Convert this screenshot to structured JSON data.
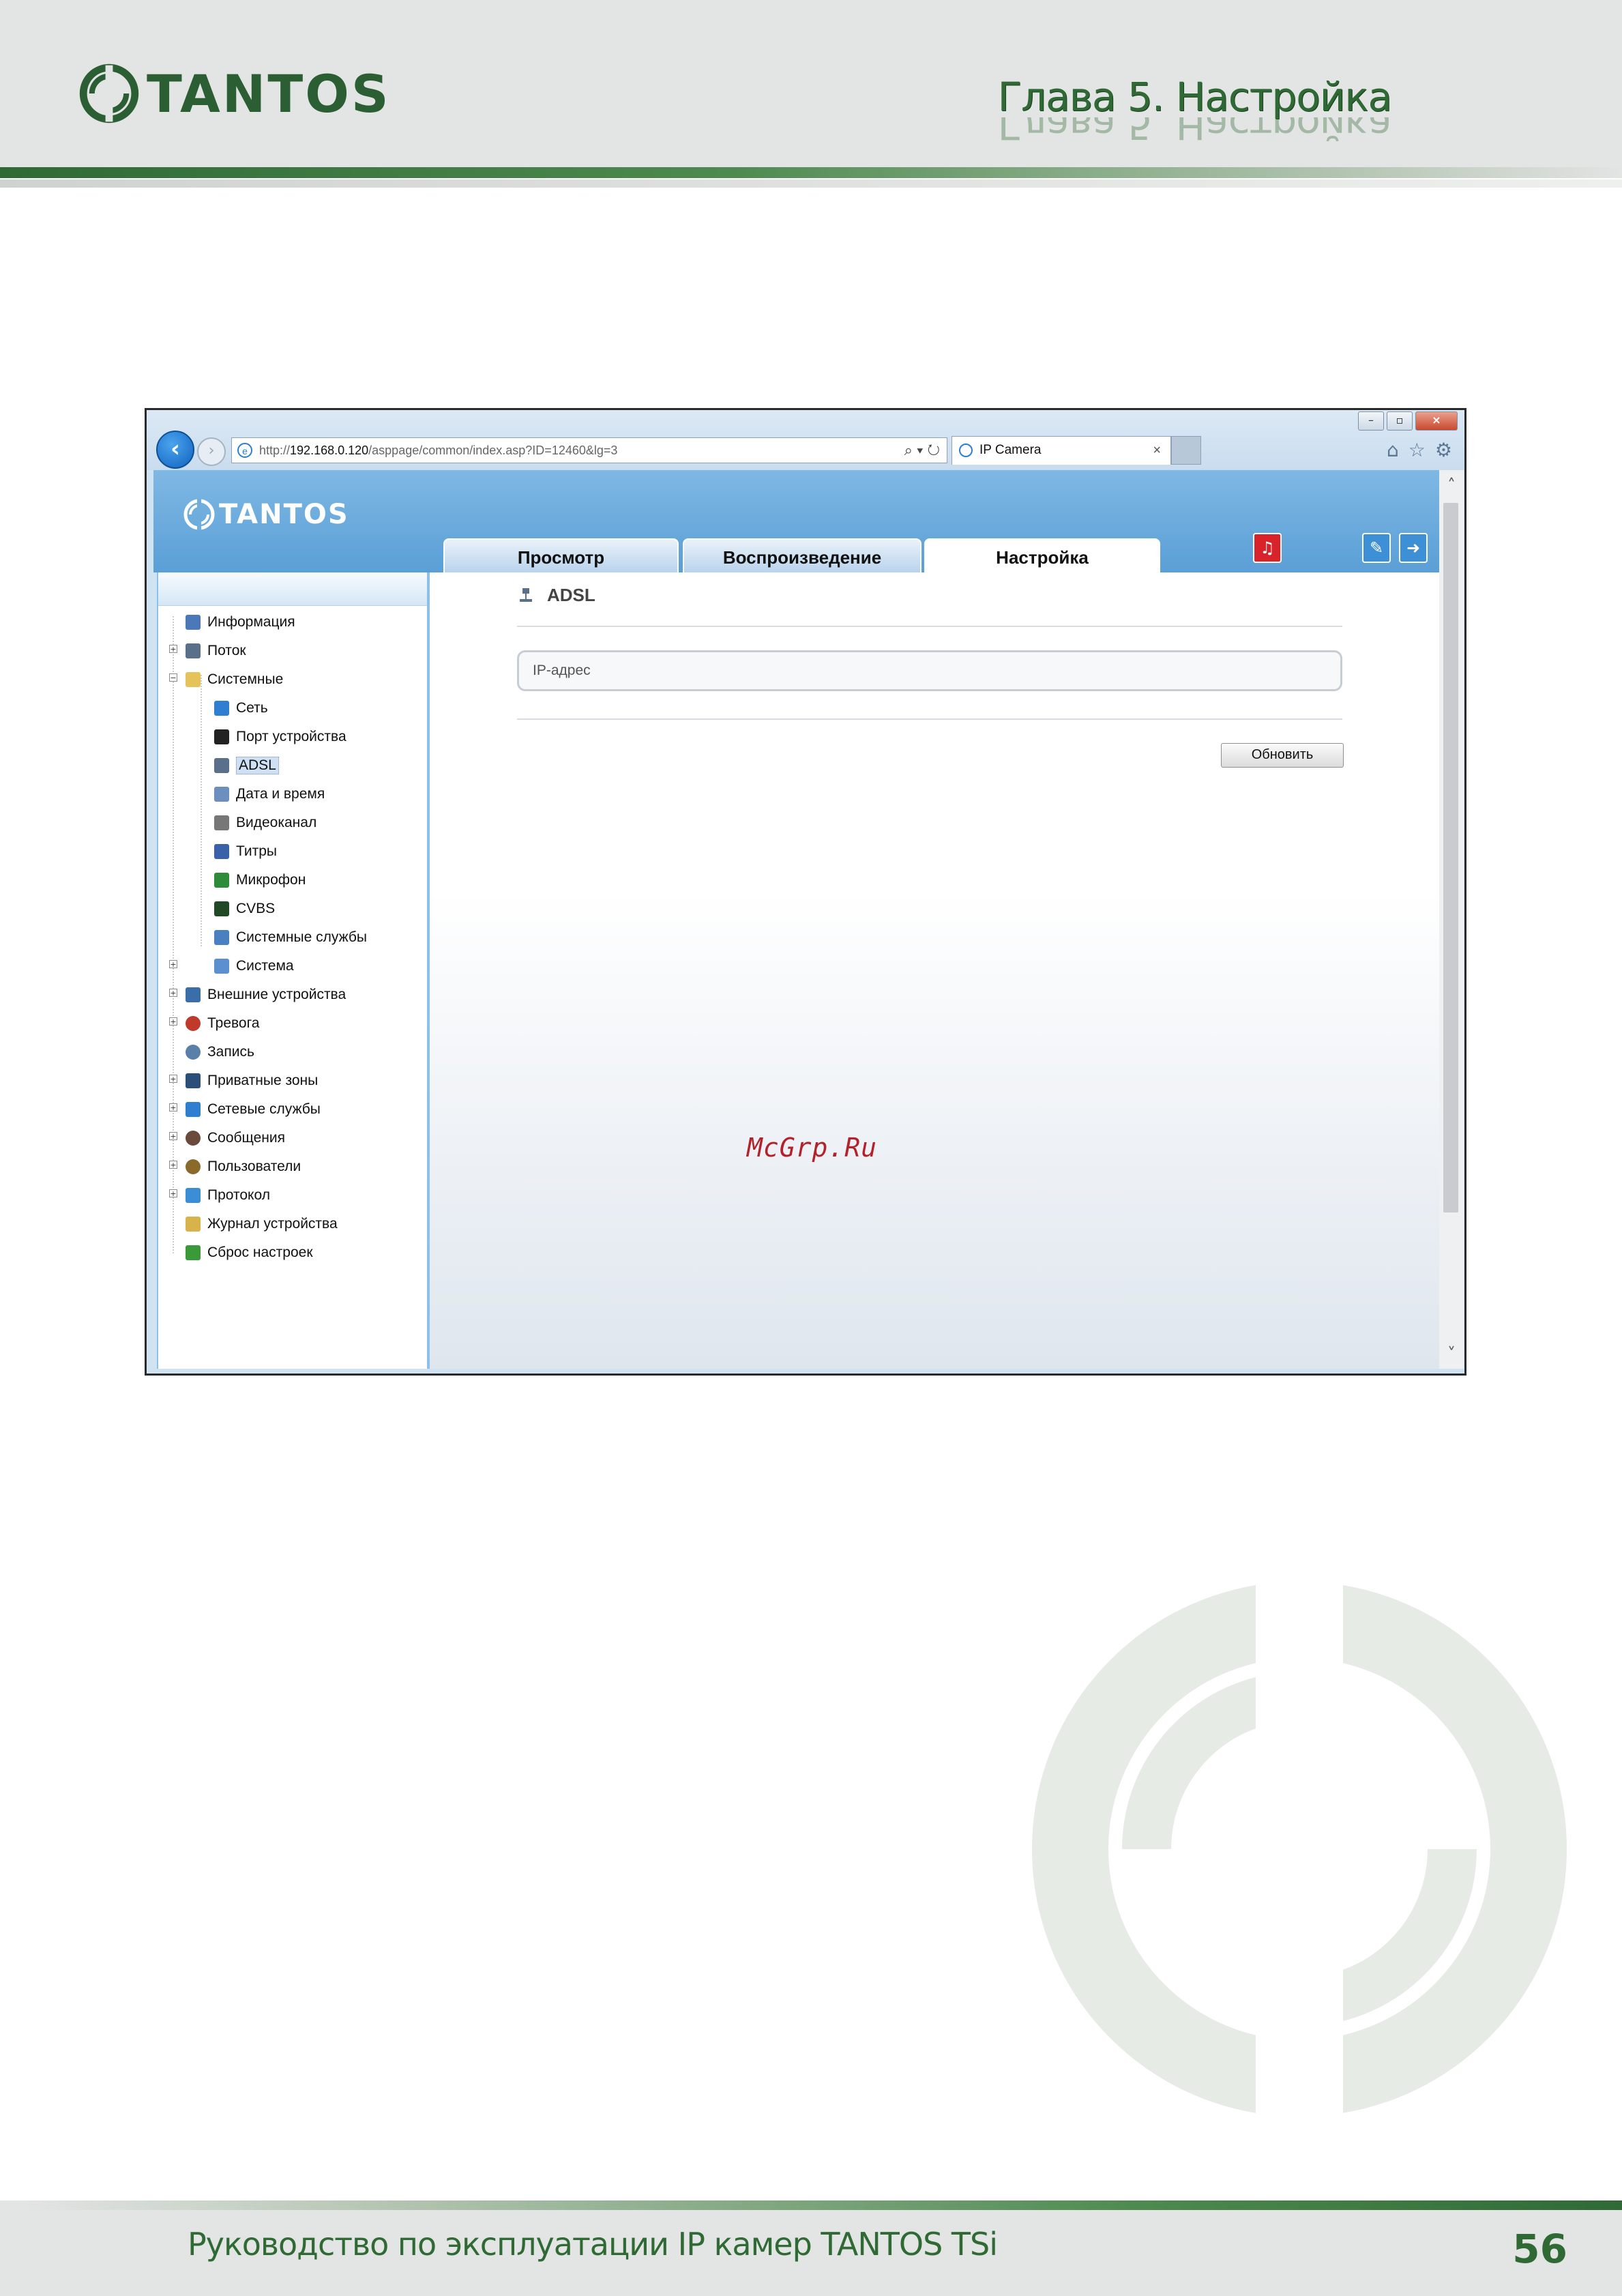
{
  "header": {
    "brand": "TANTOS",
    "chapter_title": "Глава 5. Настройка"
  },
  "browser": {
    "url_prefix": "http://",
    "url_host": "192.168.0.120",
    "url_path": "/asppage/common/index.asp?ID=12460&lg=3",
    "tab_title": "IP Camera",
    "tab_close": "×",
    "win_minimize": "–",
    "win_restore": "▫",
    "win_close": "×"
  },
  "camera_ui": {
    "brand": "TANTOS",
    "tabs": [
      {
        "label": "Просмотр"
      },
      {
        "label": "Воспроизведение"
      },
      {
        "label": "Настройка"
      }
    ],
    "tree": [
      {
        "label": "Информация",
        "icon": "info-icon"
      },
      {
        "label": "Поток",
        "icon": "stream-icon"
      },
      {
        "label": "Системные",
        "icon": "folder-icon"
      },
      {
        "label": "Сеть",
        "icon": "network-icon"
      },
      {
        "label": "Порт устройства",
        "icon": "port-icon"
      },
      {
        "label": "ADSL",
        "icon": "adsl-icon"
      },
      {
        "label": "Дата и время",
        "icon": "clock-icon"
      },
      {
        "label": "Видеоканал",
        "icon": "camera-icon"
      },
      {
        "label": "Титры",
        "icon": "titles-icon"
      },
      {
        "label": "Микрофон",
        "icon": "microphone-icon"
      },
      {
        "label": "CVBS",
        "icon": "cvbs-icon"
      },
      {
        "label": "Системные службы",
        "icon": "services-icon"
      },
      {
        "label": "Система",
        "icon": "system-icon"
      },
      {
        "label": "Внешние устройства",
        "icon": "usb-icon"
      },
      {
        "label": "Тревога",
        "icon": "alarm-icon"
      },
      {
        "label": "Запись",
        "icon": "record-icon"
      },
      {
        "label": "Приватные зоны",
        "icon": "privacy-icon"
      },
      {
        "label": "Сетевые службы",
        "icon": "network-services-icon"
      },
      {
        "label": "Сообщения",
        "icon": "messages-icon"
      },
      {
        "label": "Пользователи",
        "icon": "users-icon"
      },
      {
        "label": "Протокол",
        "icon": "protocol-icon"
      },
      {
        "label": "Журнал устройства",
        "icon": "log-icon"
      },
      {
        "label": "Сброс настроек",
        "icon": "reset-icon"
      }
    ],
    "section_title": "ADSL",
    "ip_field_label": "IP-адрес",
    "update_button": "Обновить"
  },
  "watermark": "McGrp.Ru",
  "footer": {
    "title": "Руководство по эксплуатации IP камер TANTOS TSi",
    "page_number": "56"
  },
  "colors": {
    "brand_green": "#2f6a35",
    "ui_blue": "#5a9fd6",
    "alarm_red": "#d9232a"
  }
}
